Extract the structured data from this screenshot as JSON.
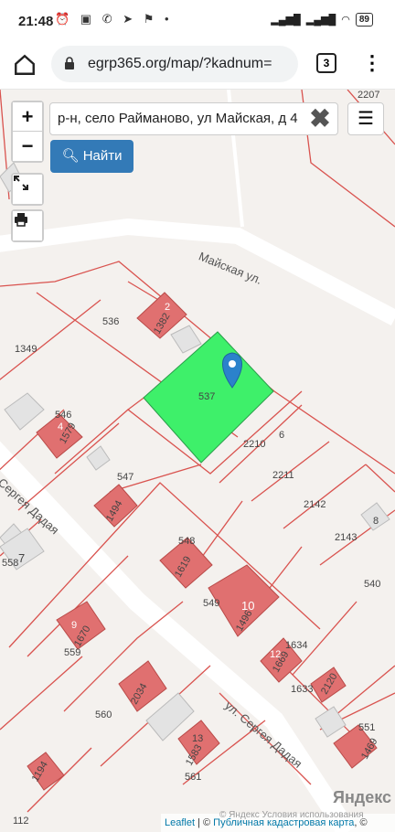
{
  "status_bar": {
    "time": "21:48",
    "battery": "89"
  },
  "browser": {
    "url": "egrp365.org/map/?kadnum=",
    "tab_count": "3"
  },
  "map_controls": {
    "zoom_in": "+",
    "zoom_out": "−",
    "search_value": "р-н, село Райманово, ул Майская, д 4",
    "search_clear": "✖",
    "find_label": "Найти",
    "menu_label": "☰"
  },
  "streets": {
    "mayskaya": "Майская ул.",
    "sergeya_dadaya_top": "Сергея Дадая",
    "sergeya_dadaya_bottom": "ул. Сергея Дадая"
  },
  "parcel_labels": [
    "536",
    "1382",
    "1349",
    "537",
    "2210",
    "6",
    "2211",
    "546",
    "1579",
    "547",
    "1494",
    "2142",
    "2143",
    "8",
    "7",
    "558",
    "548",
    "1619",
    "549",
    "1496",
    "540",
    "1670",
    "559",
    "1634",
    "1669",
    "1633",
    "2120",
    "560",
    "2034",
    "13",
    "1583",
    "561",
    "551",
    "1469",
    "1194",
    "112",
    "2207",
    "10",
    "9",
    "12",
    "2",
    "4"
  ],
  "selected_parcel": {
    "number": "537",
    "color": "#3ef06a"
  },
  "attribution": {
    "leaflet": "Leaflet",
    "separator": " | © ",
    "cadastral": "Публичная кадастровая карта",
    "tail": ", ©",
    "yandex_terms": "© Яндекс Условия использования"
  },
  "yandex_logo": "Яндекс",
  "colors": {
    "parcel_line": "#d9534f",
    "building_fill": "#e07070",
    "find_button": "#337ab7"
  }
}
